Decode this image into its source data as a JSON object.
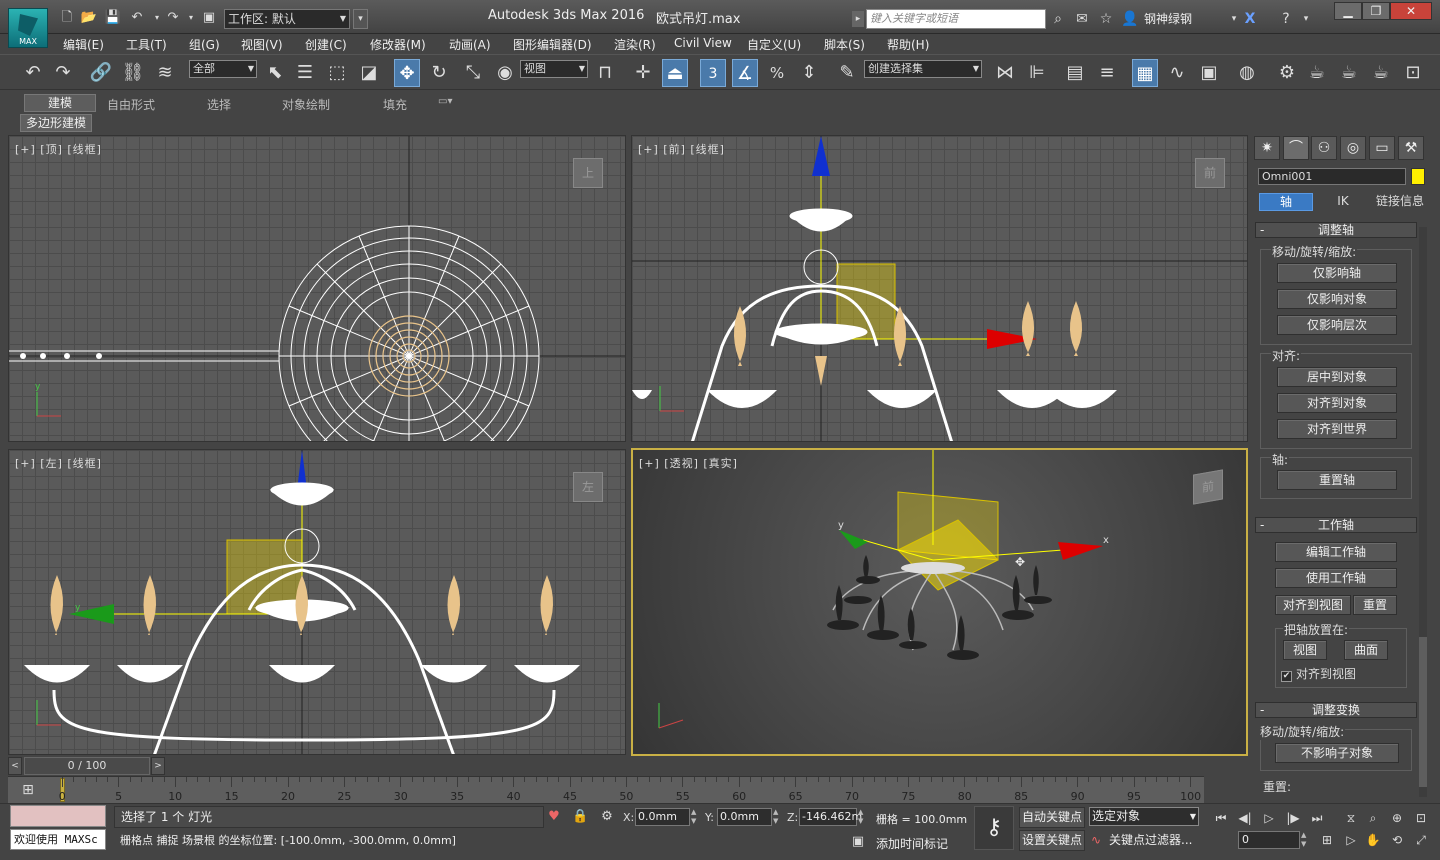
{
  "title_bar": {
    "app_name": "Autodesk 3ds Max 2016",
    "file_name": "欧式吊灯.max",
    "workspace_label": "工作区: 默认",
    "search_placeholder": "键入关键字或短语",
    "user_name": "钢神绿钢",
    "logo_text": "MAX"
  },
  "menu": [
    "编辑(E)",
    "工具(T)",
    "组(G)",
    "视图(V)",
    "创建(C)",
    "修改器(M)",
    "动画(A)",
    "图形编辑器(D)",
    "渲染(R)",
    "Civil View",
    "自定义(U)",
    "脚本(S)",
    "帮助(H)"
  ],
  "toolbar": {
    "filter": "全部",
    "ref_coord": "视图",
    "selection_set": "创建选择集",
    "snap_value": "3",
    "buttons": [
      "undo-icon",
      "redo-icon",
      "link-icon",
      "unlink-icon",
      "bind-space-warp-icon",
      "select-object-icon",
      "select-by-name-icon",
      "rect-region-icon",
      "window-crossing-icon",
      "move-icon",
      "rotate-icon",
      "scale-icon",
      "pivot-icon",
      "manipulate-icon",
      "keyboard-shortcut-icon",
      "snap-3d-icon",
      "angle-snap-icon",
      "percent-snap-icon",
      "spinner-snap-icon",
      "edit-named-selection-icon",
      "mirror-icon",
      "align-icon",
      "layer-manager-icon",
      "scene-explorer-icon",
      "toggle-ribbon-icon",
      "curve-editor-icon",
      "schematic-view-icon",
      "material-editor-icon",
      "render-setup-icon",
      "rendered-frame-icon",
      "render-production-icon",
      "render-iterative-icon",
      "render-online-icon"
    ]
  },
  "ribbon": {
    "tabs": [
      "建模",
      "自由形式",
      "选择",
      "对象绘制",
      "填充"
    ],
    "active_tab": "建模",
    "panel_button": "多边形建模"
  },
  "viewports": {
    "top": {
      "label": "[+] [顶] [线框]",
      "cube": "上"
    },
    "front": {
      "label": "[+] [前] [线框]",
      "cube": "前"
    },
    "left": {
      "label": "[+] [左] [线框]",
      "cube": "左"
    },
    "perspective": {
      "label": "[+] [透视] [真实]",
      "cube": "前",
      "axis_x": "x",
      "axis_y": "y"
    }
  },
  "command_panel": {
    "object_name": "Omni001",
    "object_color": "#ffef00",
    "sub_tabs": [
      "轴",
      "IK",
      "链接信息"
    ],
    "active_sub_tab": "轴",
    "rollouts": {
      "adjust_pivot": {
        "title": "调整轴",
        "move_rotate_scale_label": "移动/旋转/缩放:",
        "buttons": [
          "仅影响轴",
          "仅影响对象",
          "仅影响层次"
        ],
        "align_label": "对齐:",
        "align_buttons": [
          "居中到对象",
          "对齐到对象",
          "对齐到世界"
        ],
        "pivot_label": "轴:",
        "reset_pivot": "重置轴"
      },
      "working_pivot": {
        "title": "工作轴",
        "buttons": [
          "编辑工作轴",
          "使用工作轴"
        ],
        "align_to_view": "对齐到视图",
        "reset": "重置",
        "place_pivot_label": "把轴放置在:",
        "view": "视图",
        "surface": "曲面",
        "align_checkbox": "对齐到视图",
        "align_checked": true
      },
      "adjust_transform": {
        "title": "调整变换",
        "move_rotate_scale_label": "移动/旋转/缩放:",
        "button": "不影响子对象",
        "reset_label": "重置:"
      }
    }
  },
  "timeline": {
    "position_label": "0 / 100",
    "current_frame": 0,
    "total_frames": 100,
    "tick_labels": [
      "0",
      "5",
      "10",
      "15",
      "20",
      "25",
      "30",
      "35",
      "40",
      "45",
      "50",
      "55",
      "60",
      "65",
      "70",
      "75",
      "80",
      "85",
      "90",
      "95",
      "100"
    ]
  },
  "status": {
    "welcome": "欢迎使用 MAXSc",
    "selection_info": "选择了 1 个 灯光",
    "prompt": "栅格点 捕捉 场景根 的坐标位置: [-100.0mm, -300.0mm, 0.0mm]",
    "x_label": "X:",
    "x_value": "0.0mm",
    "y_label": "Y:",
    "y_value": "0.0mm",
    "z_label": "Z:",
    "z_value": "-146.462m",
    "grid": "栅格 = 100.0mm",
    "add_time_tag": "添加时间标记",
    "auto_key": "自动关键点",
    "set_key": "设置关键点",
    "selected_object": "选定对象",
    "key_filters": "关键点过滤器...",
    "frame_value": "0"
  }
}
